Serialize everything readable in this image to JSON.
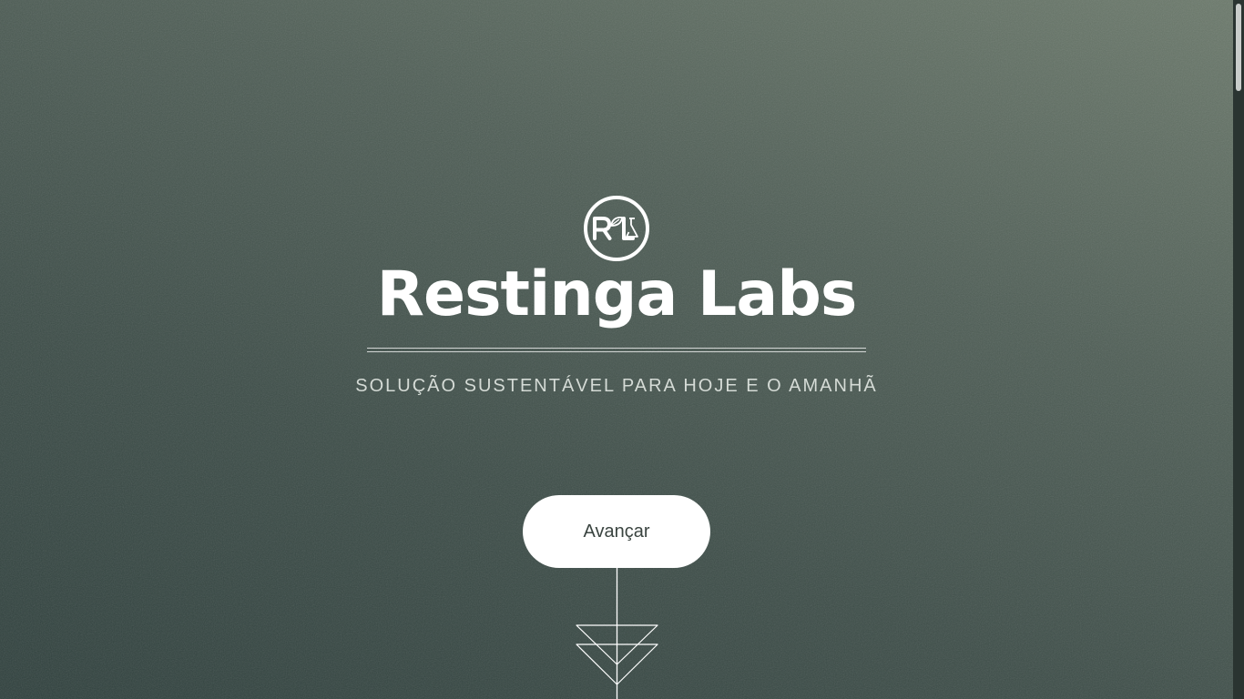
{
  "hero": {
    "logo_monogram": "R L",
    "brand_name": "Restinga Labs",
    "tagline": "SOLUÇÃO SUSTENTÁVEL PARA HOJE E O AMANHÃ",
    "cta_label": "Avançar"
  },
  "icons": {
    "logo": "restinga-labs-logo-icon",
    "scroll_indicator": "double-triangle-arrow-down-icon"
  },
  "colors": {
    "background_top": "#6c7a6c",
    "background_bottom": "#2f403d",
    "text_primary": "#ffffff",
    "button_bg": "#ffffff",
    "button_text": "#3a4440"
  }
}
